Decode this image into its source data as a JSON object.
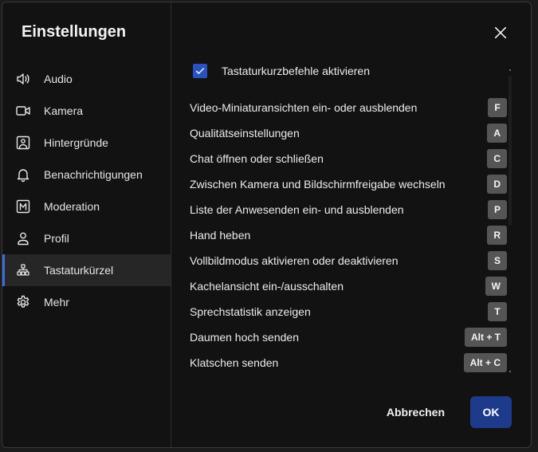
{
  "dialog": {
    "title": "Einstellungen"
  },
  "sidebar": {
    "items": [
      {
        "label": "Audio",
        "icon": "speaker-icon"
      },
      {
        "label": "Kamera",
        "icon": "camera-icon"
      },
      {
        "label": "Hintergründe",
        "icon": "image-icon"
      },
      {
        "label": "Benachrichtigungen",
        "icon": "bell-icon"
      },
      {
        "label": "Moderation",
        "icon": "moderation-m-icon"
      },
      {
        "label": "Profil",
        "icon": "person-icon"
      },
      {
        "label": "Tastaturkürzel",
        "icon": "shortcuts-icon",
        "active": true
      },
      {
        "label": "Mehr",
        "icon": "gear-icon"
      }
    ]
  },
  "shortcuts": {
    "enable_label": "Tastaturkurzbefehle aktivieren",
    "enabled": true,
    "items": [
      {
        "label": "Video-Miniaturansichten ein- oder ausblenden",
        "key": "F"
      },
      {
        "label": "Qualitätseinstellungen",
        "key": "A"
      },
      {
        "label": "Chat öffnen oder schließen",
        "key": "C"
      },
      {
        "label": "Zwischen Kamera und Bildschirmfreigabe wechseln",
        "key": "D"
      },
      {
        "label": "Liste der Anwesenden ein- und ausblenden",
        "key": "P"
      },
      {
        "label": "Hand heben",
        "key": "R"
      },
      {
        "label": "Vollbildmodus aktivieren oder deaktivieren",
        "key": "S"
      },
      {
        "label": "Kachelansicht ein-/ausschalten",
        "key": "W"
      },
      {
        "label": "Sprechstatistik anzeigen",
        "key": "T"
      },
      {
        "label": "Daumen hoch senden",
        "key": "Alt + T"
      },
      {
        "label": "Klatschen senden",
        "key": "Alt + C"
      }
    ]
  },
  "footer": {
    "cancel_label": "Abbrechen",
    "ok_label": "OK"
  },
  "colors": {
    "accent": "#3f6cd8",
    "ok_button": "#1e3a8a",
    "checkbox": "#2a52be",
    "key_badge": "#555555"
  }
}
